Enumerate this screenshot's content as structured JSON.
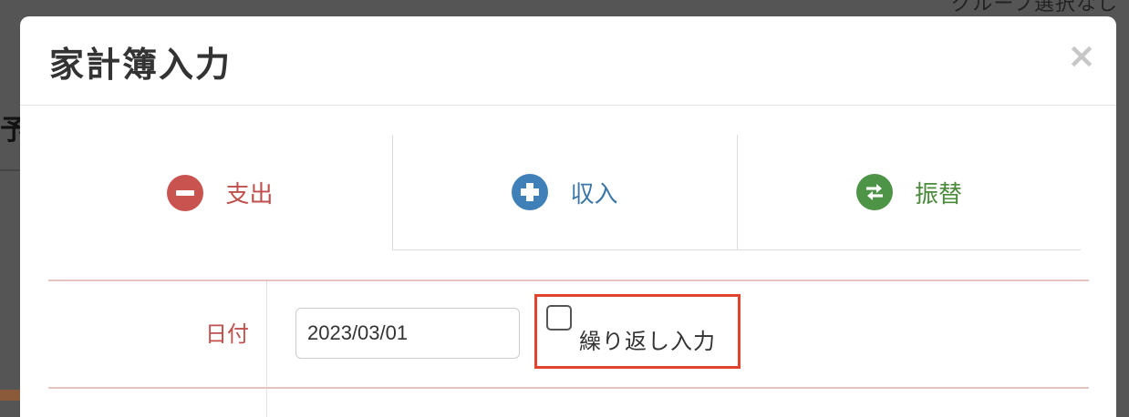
{
  "background": {
    "top_right_text": "グループ選択なし",
    "left_edge_text": "予"
  },
  "modal": {
    "title": "家計簿入力",
    "close_label": "×"
  },
  "tabs": [
    {
      "label": "支出",
      "icon": "minus-circle-icon",
      "color": "#c0504d",
      "active": true
    },
    {
      "label": "収入",
      "icon": "plus-circle-icon",
      "color": "#3c76a8",
      "active": false
    },
    {
      "label": "振替",
      "icon": "transfer-circle-icon",
      "color": "#4a8a3a",
      "active": false
    }
  ],
  "form": {
    "date_label": "日付",
    "date_value": "2023/03/01",
    "repeat_checkbox_label": "繰り返し入力",
    "repeat_checked": false
  },
  "colors": {
    "highlight_border": "#e0442c",
    "row_border": "#e6c3c1"
  }
}
